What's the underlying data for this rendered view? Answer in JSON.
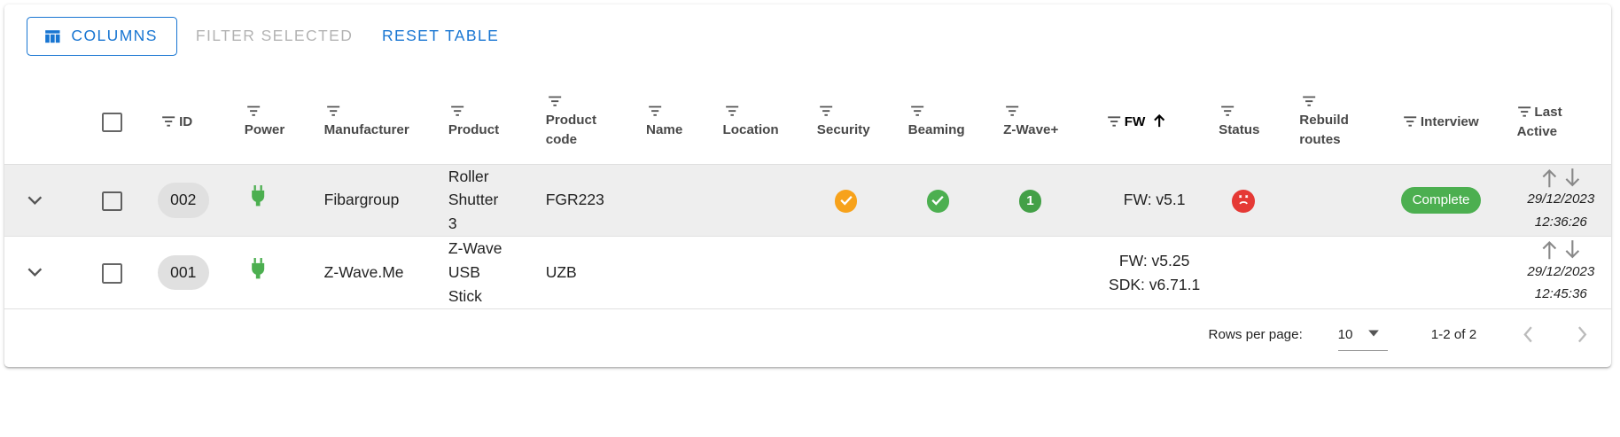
{
  "toolbar": {
    "columns_label": "Columns",
    "filter_selected_label": "Filter selected",
    "reset_table_label": "Reset table"
  },
  "columns": {
    "id": "ID",
    "power": "Power",
    "manufacturer": "Manufacturer",
    "product": "Product",
    "product_code_1": "Product",
    "product_code_2": "code",
    "name": "Name",
    "location": "Location",
    "security": "Security",
    "beaming": "Beaming",
    "zwave_plus": "Z-Wave+",
    "fw": "FW",
    "status": "Status",
    "rebuild_1": "Rebuild",
    "rebuild_2": "routes",
    "interview": "Interview",
    "last_active_1": "Last",
    "last_active_2": "Active"
  },
  "rows": [
    {
      "id": "002",
      "manufacturer": "Fibargroup",
      "product_lines": [
        "Roller",
        "Shutter",
        "3"
      ],
      "product_code": "FGR223",
      "zwave_plus_version": "1",
      "fw": "FW: v5.1",
      "interview": "Complete",
      "last_date": "29/12/2023",
      "last_time": "12:36:26"
    },
    {
      "id": "001",
      "manufacturer": "Z-Wave.Me",
      "product_lines": [
        "Z-Wave",
        "USB",
        "Stick"
      ],
      "product_code": "UZB",
      "fw_line1": "FW: v5.25",
      "fw_line2": "SDK: v6.71.1",
      "last_date": "29/12/2023",
      "last_time": "12:45:36"
    }
  ],
  "footer": {
    "rows_per_page_label": "Rows per page:",
    "rows_per_page_value": "10",
    "range": "1-2 of 2"
  },
  "colors": {
    "primary": "#1976d2",
    "green": "#4caf50",
    "orange": "#f7a21b",
    "red": "#e53935"
  },
  "icons": [
    "columns-icon",
    "filter-icon",
    "arrow-up-icon",
    "chevron-down-icon",
    "plug-icon",
    "check-circle-icon",
    "error-face-icon",
    "arrow-down-icon",
    "chevron-left-icon",
    "chevron-right-icon",
    "dropdown-icon"
  ]
}
